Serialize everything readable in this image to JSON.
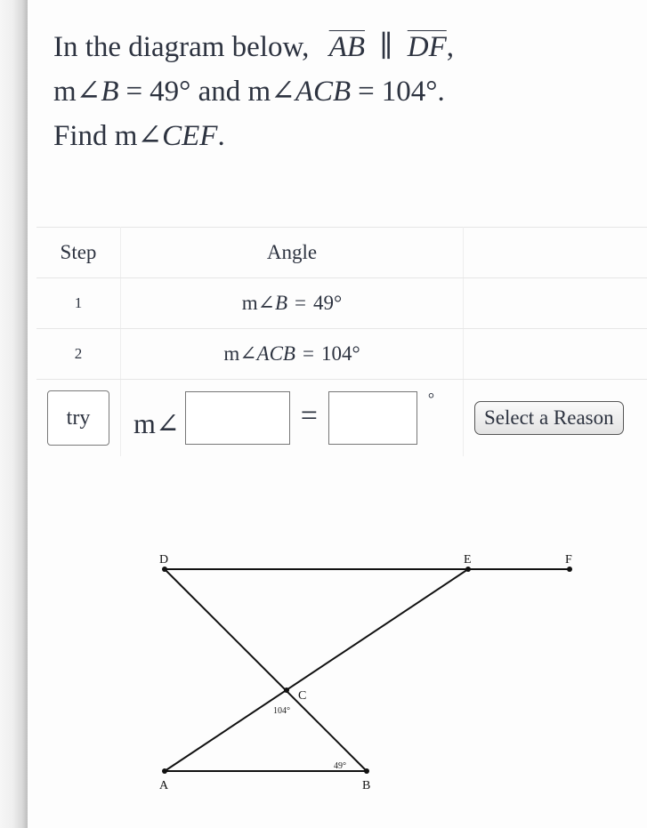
{
  "question": {
    "line1_prefix": "In the diagram below,",
    "segment1": "AB",
    "parallel_symbol": "∥",
    "segment2": "DF",
    "line1_suffix": ",",
    "line2_m1": "m∠",
    "line2_angle1": "B",
    "line2_eq1": "=",
    "line2_val1": "49°",
    "line2_and": "and",
    "line2_m2": "m∠",
    "line2_angle2": "ACB",
    "line2_eq2": "=",
    "line2_val2": "104°.",
    "line3_find": "Find",
    "line3_m": "m∠",
    "line3_angle": "CEF",
    "line3_suffix": "."
  },
  "table": {
    "headers": {
      "step": "Step",
      "angle": "Angle",
      "reason": ""
    },
    "rows": [
      {
        "step": "1",
        "m": "m∠",
        "angle": "B",
        "eq": "=",
        "value": "49°"
      },
      {
        "step": "2",
        "m": "m∠",
        "angle": "ACB",
        "eq": "=",
        "value": "104°"
      }
    ],
    "try_row": {
      "button_label": "try",
      "m_angle_prefix": "m∠",
      "angle_input_value": "",
      "eq": "=",
      "value_input_value": "",
      "degree_symbol": "°",
      "reason_button_label": "Select a Reason"
    }
  },
  "diagram": {
    "points": {
      "D": "D",
      "E": "E",
      "F": "F",
      "C": "C",
      "A": "A",
      "B": "B"
    },
    "angle_labels": {
      "acb": "104°",
      "b": "49°"
    }
  }
}
